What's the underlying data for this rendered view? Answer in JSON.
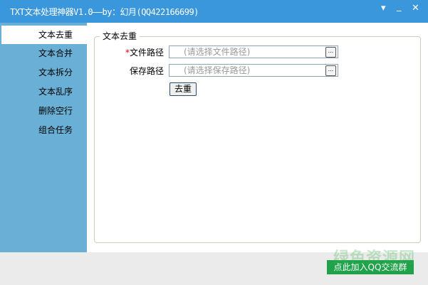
{
  "window": {
    "title": "TXT文本处理神器V1.0——by：幻月(QQ422166699)",
    "menu_icon": "▾",
    "minimize_icon": "_",
    "close_icon": "✕"
  },
  "sidebar": {
    "items": [
      {
        "label": "文本去重"
      },
      {
        "label": "文本合并"
      },
      {
        "label": "文本拆分"
      },
      {
        "label": "文本乱序"
      },
      {
        "label": "删除空行"
      },
      {
        "label": "组合任务"
      }
    ]
  },
  "panel": {
    "group_title": "文本去重",
    "required_mark": "*",
    "file_label": "文件路径",
    "file_placeholder": "(请选择文件路径)",
    "save_label": "保存路径",
    "save_placeholder": "(请选择保存路径)",
    "browse_label": "...",
    "action_label": "去重"
  },
  "footer": {
    "qq_button": "点此加入QQ交流群",
    "watermark": "绿色资源网"
  }
}
